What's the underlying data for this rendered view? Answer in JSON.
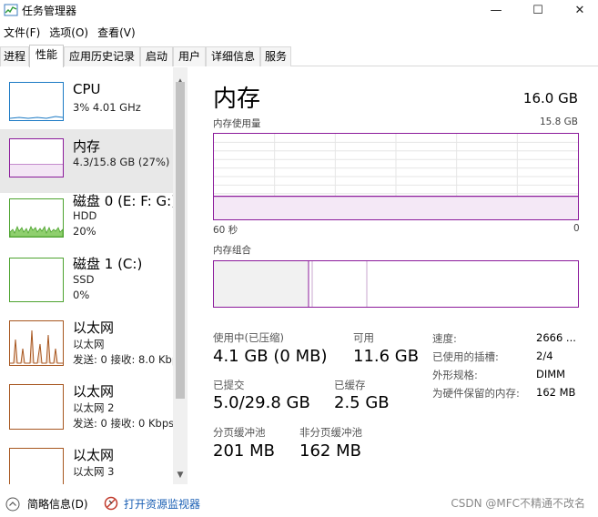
{
  "window": {
    "title": "任务管理器",
    "minimize": "—",
    "maximize": "☐",
    "close": "✕"
  },
  "menu": [
    "文件(F)",
    "选项(O)",
    "查看(V)"
  ],
  "tabs": [
    "进程",
    "性能",
    "应用历史记录",
    "启动",
    "用户",
    "详细信息",
    "服务"
  ],
  "active_tab": "性能",
  "resources": [
    {
      "name": "CPU",
      "line1": "3% 4.01 GHz",
      "line2": "",
      "color": "#1a79c4"
    },
    {
      "name": "内存",
      "line1": "4.3/15.8 GB (27%)",
      "line2": "",
      "color": "#8b1a9b"
    },
    {
      "name": "磁盘 0 (E: F: G:)",
      "line1": "HDD",
      "line2": "20%",
      "color": "#4da32f"
    },
    {
      "name": "磁盘 1 (C:)",
      "line1": "SSD",
      "line2": "0%",
      "color": "#4da32f"
    },
    {
      "name": "以太网",
      "line1": "以太网",
      "line2": "发送: 0 接收: 8.0 Kbps",
      "color": "#a7561f"
    },
    {
      "name": "以太网",
      "line1": "以太网 2",
      "line2": "发送: 0 接收: 0 Kbps",
      "color": "#a7561f"
    },
    {
      "name": "以太网",
      "line1": "以太网 3",
      "line2": "",
      "color": "#a7561f"
    }
  ],
  "detail": {
    "title": "内存",
    "total": "16.0 GB",
    "usage_label": "内存使用量",
    "usage_max": "15.8 GB",
    "time_left": "60 秒",
    "time_right": "0",
    "composition_label": "内存组合",
    "usage_level_pct": 27,
    "stats": {
      "in_use_label": "使用中(已压缩)",
      "in_use_value": "4.1 GB (0 MB)",
      "available_label": "可用",
      "available_value": "11.6 GB",
      "committed_label": "已提交",
      "committed_value": "5.0/29.8 GB",
      "cached_label": "已缓存",
      "cached_value": "2.5 GB",
      "paged_label": "分页缓冲池",
      "paged_value": "201 MB",
      "nonpaged_label": "非分页缓冲池",
      "nonpaged_value": "162 MB"
    },
    "kv": [
      {
        "label": "速度:",
        "value": "2666 ..."
      },
      {
        "label": "已使用的插槽:",
        "value": "2/4"
      },
      {
        "label": "外形规格:",
        "value": "DIMM"
      },
      {
        "label": "为硬件保留的内存:",
        "value": "162 MB"
      }
    ]
  },
  "footer": {
    "brief": "简略信息(D)",
    "monitor": "打开资源监视器"
  },
  "watermark": "CSDN @MFC不精通不改名"
}
